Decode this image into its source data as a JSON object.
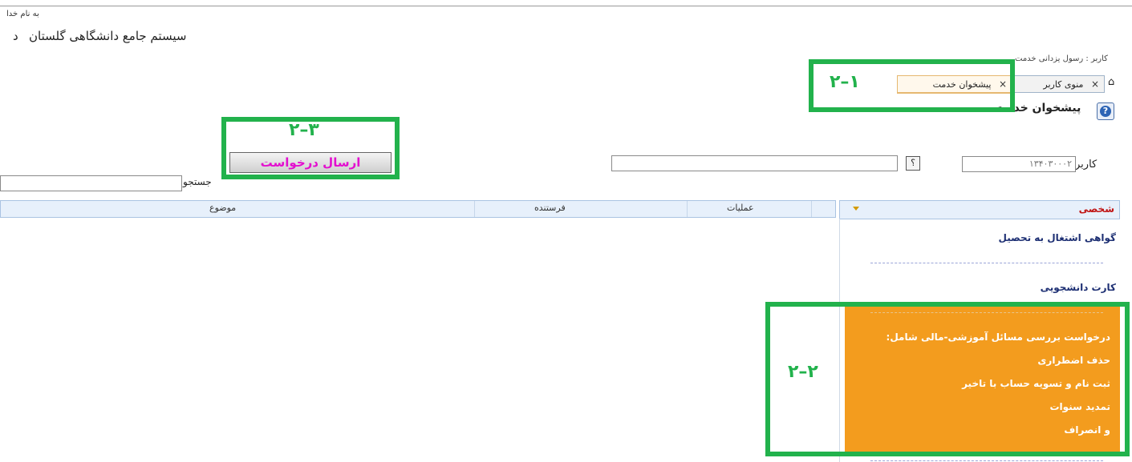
{
  "header": {
    "top_small": "به نام خدا",
    "system_title": "سیستم جامع دانشگاهی گلستان",
    "system_title_tail": "د",
    "user_line": "کاربر : رسول یزدانی  خدمت"
  },
  "tabs": [
    {
      "label": "منوی کاربر",
      "close": "×"
    },
    {
      "label": "پیشخوان خدمت",
      "close": "×"
    }
  ],
  "page": {
    "title": "پیشخوان خدمت",
    "help_icon": "?"
  },
  "form": {
    "user_label": "کاربر",
    "user_value": "۱۳۴۰۳۰۰۰۲",
    "text_field": "",
    "query_button": "؟",
    "send_button": "ارسال درخواست",
    "search_label": "جستجو",
    "search_value": ""
  },
  "grid": {
    "columns": [
      "موضوع",
      "فرستنده",
      "عملیات"
    ]
  },
  "sidebar": {
    "header": "شخصی",
    "items": [
      "گواهی اشتغال به تحصیل",
      "کارت دانشجویی"
    ],
    "highlighted_items": [
      "درخواست بررسی مسائل آموزشی-مالی شامل:",
      "حذف اضطراری",
      "ثبت نام و تسویه حساب با تاخیر",
      "تمدید سنوات",
      "و انصراف"
    ]
  },
  "annotations": {
    "label_1": "۲–۱",
    "label_2": "۲–۲",
    "label_3": "۲–۳"
  },
  "colors": {
    "annotation_green": "#22b24c",
    "highlight_orange": "#f39c1e",
    "send_button_text": "#e30fcf"
  }
}
